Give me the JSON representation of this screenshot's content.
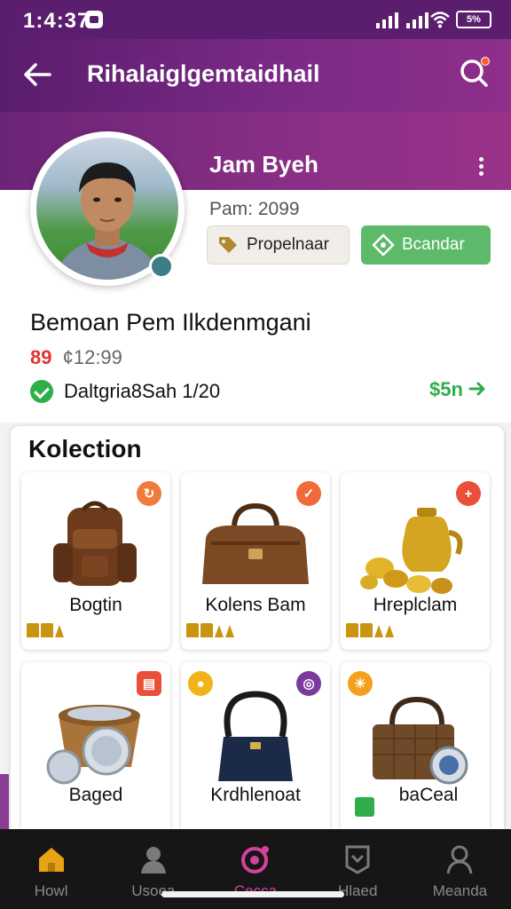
{
  "status_bar": {
    "time": "1:4:37",
    "battery": "5%"
  },
  "app_bar": {
    "title": "Rihalaiglgemtaidhail"
  },
  "profile": {
    "name": "Jam Byeh",
    "points": "Pam: 2099",
    "primary_button": "Propelnaar",
    "secondary_button": "Bcandar",
    "member_title": "Bemoan Pem Ilkdenmgani",
    "price_old": "89",
    "price_new": "¢12:99",
    "verified_text": "Daltgria8Sah 1/20",
    "verified_link": "$5n"
  },
  "collection": {
    "title": "Kolection",
    "items": [
      {
        "label": "Bogtin",
        "badge_color": "#f07b3c",
        "badge_symbol": "↻"
      },
      {
        "label": "Kolens Bam",
        "badge_color": "#f06a3a",
        "badge_symbol": "✓"
      },
      {
        "label": "Hreplclam",
        "badge_color": "#e8503a",
        "badge_symbol": "+"
      },
      {
        "label": "Baged",
        "badge_color": "#e8503a",
        "badge_symbol": "▤"
      },
      {
        "label": "Krdhlenoat",
        "badge_color": "#f1b418",
        "badge_symbol": "●"
      },
      {
        "label": "baCeal",
        "badge_color": "#f5a01c",
        "badge_symbol": "☀"
      }
    ]
  },
  "bottom_nav": {
    "items": [
      {
        "label": "Howl",
        "icon": "home-icon",
        "active": false
      },
      {
        "label": "Usoea",
        "icon": "person-icon",
        "active": false
      },
      {
        "label": "Cecca",
        "icon": "camera-icon",
        "active": true
      },
      {
        "label": "Hlaed",
        "icon": "badge-icon",
        "active": false
      },
      {
        "label": "Meanda",
        "icon": "profile-icon",
        "active": false
      }
    ]
  },
  "colors": {
    "brand": "#7a2a85",
    "accent": "#5cba6a",
    "nav_active": "#d5409e"
  }
}
